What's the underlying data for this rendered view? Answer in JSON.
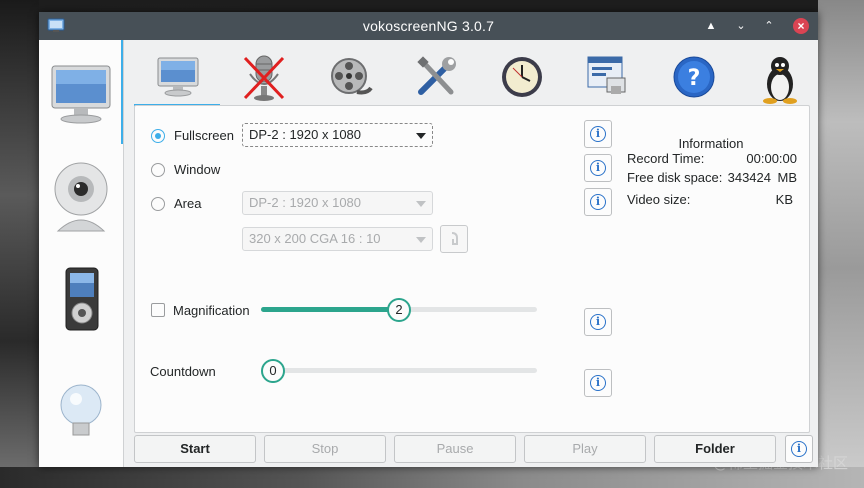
{
  "window": {
    "title": "vokoscreenNG 3.0.7"
  },
  "side_tabs": [
    {
      "name": "screencast-tab",
      "icon": "monitor-icon"
    },
    {
      "name": "camera-tab",
      "icon": "webcam-icon"
    },
    {
      "name": "player-tab",
      "icon": "media-player-icon"
    },
    {
      "name": "log-tab",
      "icon": "lightbulb-icon"
    }
  ],
  "top_tabs": [
    {
      "name": "screen",
      "icon": "monitor-icon"
    },
    {
      "name": "audio",
      "icon": "microphone-muted-icon"
    },
    {
      "name": "video",
      "icon": "film-reel-icon"
    },
    {
      "name": "tools",
      "icon": "tools-icon"
    },
    {
      "name": "timer",
      "icon": "clock-icon"
    },
    {
      "name": "window-capture",
      "icon": "windows-icon"
    },
    {
      "name": "help",
      "icon": "help-icon"
    },
    {
      "name": "system",
      "icon": "tux-icon"
    }
  ],
  "capture": {
    "fullscreen_label": "Fullscreen",
    "window_label": "Window",
    "area_label": "Area",
    "fullscreen_screen": "DP-2 :  1920 x 1080",
    "area_screen": "DP-2 :  1920 x 1080",
    "area_size": "320 x 200 CGA 16 : 10",
    "selected": "Fullscreen"
  },
  "magnification": {
    "label": "Magnification",
    "value": "2",
    "fraction": 0.5
  },
  "countdown": {
    "label": "Countdown",
    "value": "0",
    "fraction": 0.0
  },
  "information": {
    "title": "Information",
    "record_time_label": "Record Time:",
    "record_time_value": "00:00:00",
    "free_disk_label": "Free disk space:",
    "free_disk_value": "343424",
    "free_disk_unit": "MB",
    "video_size_label": "Video size:",
    "video_size_value": "",
    "video_size_unit": "KB"
  },
  "buttons": {
    "start": "Start",
    "stop": "Stop",
    "pause": "Pause",
    "play": "Play",
    "folder": "Folder"
  },
  "watermark": "@稀土掘金技术社区",
  "colors": {
    "accent": "#3daee9",
    "slider": "#2ca58d",
    "titlebar": "#475057",
    "close": "#da4453"
  }
}
